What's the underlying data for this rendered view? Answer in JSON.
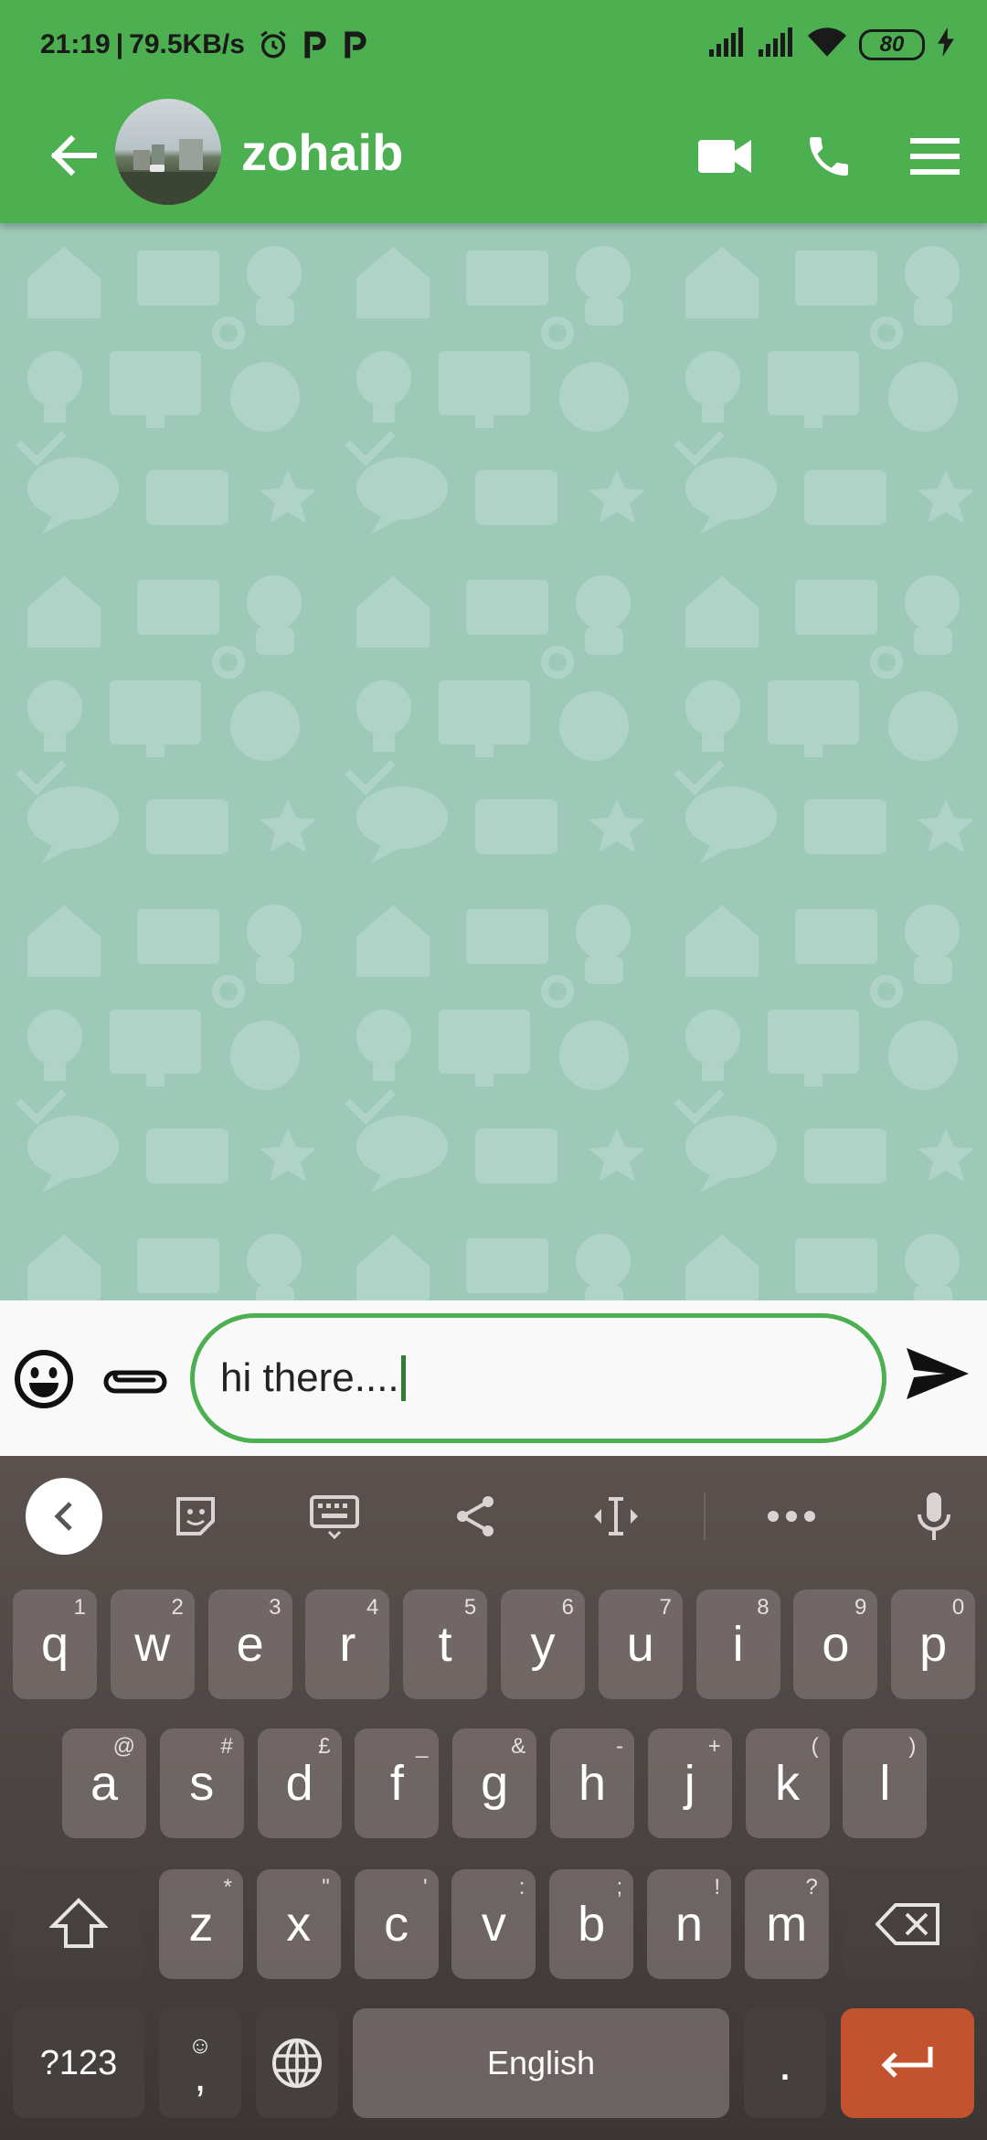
{
  "status_bar": {
    "time": "21:19",
    "separator": "|",
    "net_speed": "79.5KB/s",
    "battery": "80"
  },
  "header": {
    "contact_name": "zohaib"
  },
  "composer": {
    "input_value": "hi there...."
  },
  "keyboard": {
    "row1": [
      {
        "k": "q",
        "h": "1"
      },
      {
        "k": "w",
        "h": "2"
      },
      {
        "k": "e",
        "h": "3"
      },
      {
        "k": "r",
        "h": "4"
      },
      {
        "k": "t",
        "h": "5"
      },
      {
        "k": "y",
        "h": "6"
      },
      {
        "k": "u",
        "h": "7"
      },
      {
        "k": "i",
        "h": "8"
      },
      {
        "k": "o",
        "h": "9"
      },
      {
        "k": "p",
        "h": "0"
      }
    ],
    "row2": [
      {
        "k": "a",
        "h": "@"
      },
      {
        "k": "s",
        "h": "#"
      },
      {
        "k": "d",
        "h": "£"
      },
      {
        "k": "f",
        "h": "_"
      },
      {
        "k": "g",
        "h": "&"
      },
      {
        "k": "h",
        "h": "-"
      },
      {
        "k": "j",
        "h": "+"
      },
      {
        "k": "k",
        "h": "("
      },
      {
        "k": "l",
        "h": ")"
      }
    ],
    "row3": [
      {
        "k": "z",
        "h": "*"
      },
      {
        "k": "x",
        "h": "\""
      },
      {
        "k": "c",
        "h": "'"
      },
      {
        "k": "v",
        "h": ":"
      },
      {
        "k": "b",
        "h": ";"
      },
      {
        "k": "n",
        "h": "!"
      },
      {
        "k": "m",
        "h": "?"
      }
    ],
    "symbols_label": "?123",
    "comma_label": ",",
    "space_label": "English",
    "period_label": "."
  },
  "colors": {
    "app_bar": "#4caf50",
    "chat_background": "#9ec9b9",
    "input_border": "#4caf50",
    "enter_key": "#c2532e"
  },
  "icons": {
    "header": [
      "arrow-left-icon",
      "video-camera-icon",
      "phone-icon",
      "menu-icon"
    ],
    "composer": [
      "emoji-icon",
      "paperclip-icon",
      "send-icon"
    ],
    "keyboard_toolbar": [
      "chevron-left-icon",
      "sticker-icon",
      "keyboard-icon",
      "share-icon",
      "text-cursor-icon",
      "more-icon",
      "microphone-icon"
    ]
  }
}
